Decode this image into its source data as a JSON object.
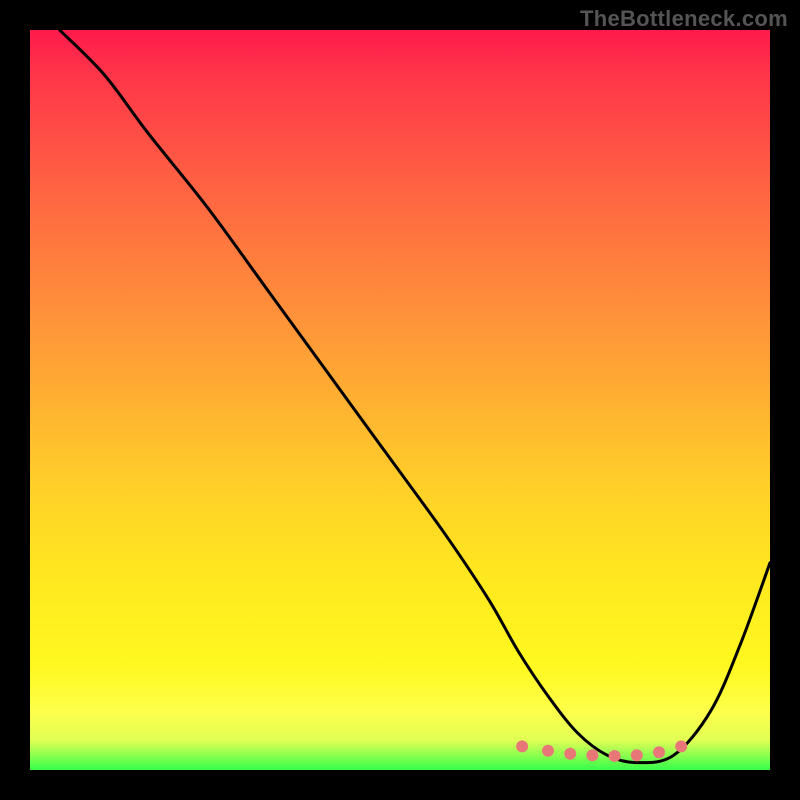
{
  "watermark": "TheBottleneck.com",
  "chart_data": {
    "type": "line",
    "title": "",
    "xlabel": "",
    "ylabel": "",
    "xlim": [
      0,
      100
    ],
    "ylim": [
      0,
      100
    ],
    "background": "gradient-red-to-green",
    "series": [
      {
        "name": "bottleneck-curve",
        "color": "#000000",
        "x": [
          4,
          10,
          16,
          24,
          32,
          40,
          48,
          56,
          62,
          66,
          70,
          74,
          78,
          82,
          87,
          92,
          96,
          100
        ],
        "values": [
          100,
          94,
          86,
          76,
          65,
          54,
          43,
          32,
          23,
          16,
          10,
          5,
          2,
          1,
          2,
          8,
          17,
          28
        ]
      }
    ],
    "markers": {
      "name": "optimal-range",
      "color": "#e87878",
      "radius": 6,
      "x": [
        66.5,
        70,
        73,
        76,
        79,
        82,
        85,
        88
      ],
      "values": [
        3.2,
        2.6,
        2.2,
        2.0,
        1.9,
        2.0,
        2.4,
        3.2
      ]
    }
  }
}
